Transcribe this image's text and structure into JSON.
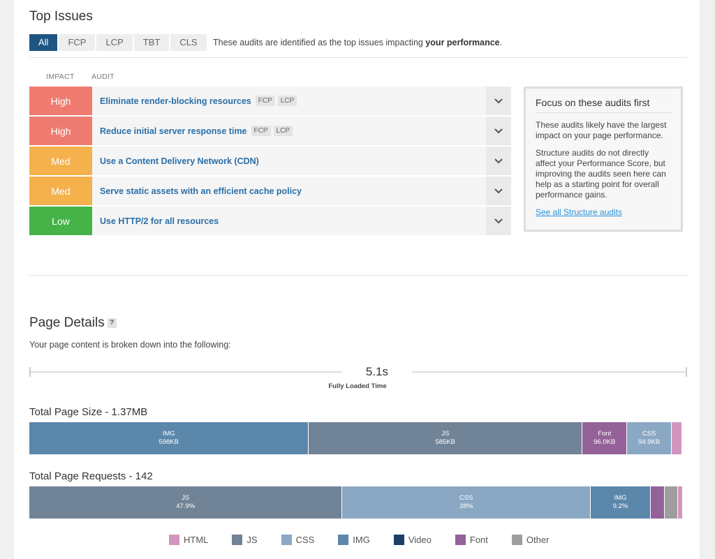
{
  "top_issues": {
    "title": "Top Issues",
    "filters": [
      "All",
      "FCP",
      "LCP",
      "TBT",
      "CLS"
    ],
    "description_prefix": "These audits are identified as the top issues impacting ",
    "description_bold": "your performance",
    "description_suffix": ".",
    "col_impact": "IMPACT",
    "col_audit": "AUDIT",
    "issues": [
      {
        "impact": "High",
        "color": "#ef7b70",
        "audit": "Eliminate render-blocking resources",
        "tags": [
          "FCP",
          "LCP"
        ]
      },
      {
        "impact": "High",
        "color": "#ef7b70",
        "audit": "Reduce initial server response time",
        "tags": [
          "FCP",
          "LCP"
        ]
      },
      {
        "impact": "Med",
        "color": "#f5b14c",
        "audit": "Use a Content Delivery Network (CDN)",
        "tags": []
      },
      {
        "impact": "Med",
        "color": "#f5b14c",
        "audit": "Serve static assets with an efficient cache policy",
        "tags": []
      },
      {
        "impact": "Low",
        "color": "#45b347",
        "audit": "Use HTTP/2 for all resources",
        "tags": []
      }
    ],
    "focus": {
      "title": "Focus on these audits first",
      "p1": "These audits likely have the largest impact on your page performance.",
      "p2": "Structure audits do not directly affect your Performance Score, but improving the audits seen here can help as a starting point for overall performance gains.",
      "link": "See all Structure audits"
    }
  },
  "page_details": {
    "title": "Page Details",
    "help": "?",
    "subtitle": "Your page content is broken down into the following:",
    "fully_loaded_value": "5.1s",
    "fully_loaded_label": "Fully Loaded Time",
    "size_title": "Total Page Size - 1.37MB",
    "requests_title": "Total Page Requests - 142"
  },
  "chart_data": [
    {
      "type": "bar",
      "title": "Total Page Size - 1.37MB",
      "series": [
        {
          "name": "IMG",
          "value": 598,
          "label": "598KB",
          "color": "#5b87ab"
        },
        {
          "name": "JS",
          "value": 585,
          "label": "585KB",
          "color": "#718396"
        },
        {
          "name": "Font",
          "value": 96.0,
          "label": "96.0KB",
          "color": "#946199"
        },
        {
          "name": "CSS",
          "value": 94.9,
          "label": "94.9KB",
          "color": "#8aa8c4"
        },
        {
          "name": "HTML",
          "value": 22,
          "label": "",
          "color": "#d295be"
        },
        {
          "name": "Other",
          "value": 2,
          "label": "",
          "color": "#9e9e9e"
        }
      ]
    },
    {
      "type": "bar",
      "title": "Total Page Requests - 142",
      "series": [
        {
          "name": "JS",
          "value": 47.9,
          "label": "47.9%",
          "color": "#718396"
        },
        {
          "name": "CSS",
          "value": 38,
          "label": "38%",
          "color": "#8aa8c4"
        },
        {
          "name": "IMG",
          "value": 9.2,
          "label": "9.2%",
          "color": "#5b87ab"
        },
        {
          "name": "Font",
          "value": 2.1,
          "label": "",
          "color": "#946199"
        },
        {
          "name": "Other",
          "value": 2.1,
          "label": "",
          "color": "#9e9e9e"
        },
        {
          "name": "HTML",
          "value": 0.7,
          "label": "",
          "color": "#d295be"
        }
      ]
    }
  ],
  "legend": [
    {
      "name": "HTML",
      "color": "#d295be"
    },
    {
      "name": "JS",
      "color": "#718396"
    },
    {
      "name": "CSS",
      "color": "#8aa8c4"
    },
    {
      "name": "IMG",
      "color": "#5b87ab"
    },
    {
      "name": "Video",
      "color": "#1c3f66"
    },
    {
      "name": "Font",
      "color": "#946199"
    },
    {
      "name": "Other",
      "color": "#9e9e9e"
    }
  ]
}
